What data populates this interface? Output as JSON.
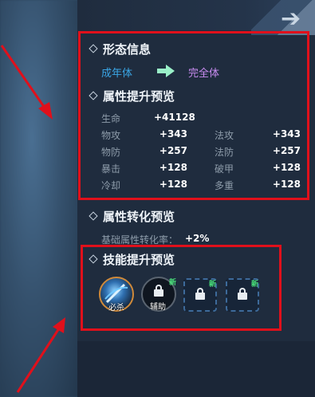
{
  "form_info": {
    "title": "形态信息",
    "from_form": "成年体",
    "to_form": "完全体",
    "colors": {
      "from": "#3aa6e6",
      "to": "#c88cf0",
      "arrow": "#9af0c8"
    }
  },
  "attr_preview": {
    "title": "属性提升预览",
    "hp": {
      "label": "生命",
      "value": "+41128"
    },
    "rows": [
      {
        "left_label": "物攻",
        "left_value": "+343",
        "right_label": "法攻",
        "right_value": "+343"
      },
      {
        "left_label": "物防",
        "left_value": "+257",
        "right_label": "法防",
        "right_value": "+257"
      },
      {
        "left_label": "暴击",
        "left_value": "+128",
        "right_label": "破甲",
        "right_value": "+128"
      },
      {
        "left_label": "冷却",
        "left_value": "+128",
        "right_label": "多重",
        "right_value": "+128"
      }
    ]
  },
  "attr_transform": {
    "title": "属性转化预览",
    "rate_label": "基础属性转化率：",
    "rate_value": "+2%"
  },
  "skill_preview": {
    "title": "技能提升预览",
    "skills": [
      {
        "label": "必杀",
        "icon": "sword-slash-icon",
        "new": false
      },
      {
        "label": "辅助",
        "icon": "lock-icon",
        "new": true,
        "new_label": "新"
      },
      {
        "label": "",
        "icon": "lock-icon",
        "new": true,
        "new_label": "新"
      },
      {
        "label": "",
        "icon": "lock-icon",
        "new": true,
        "new_label": "新"
      }
    ]
  },
  "annotation_color": "#e0101b"
}
